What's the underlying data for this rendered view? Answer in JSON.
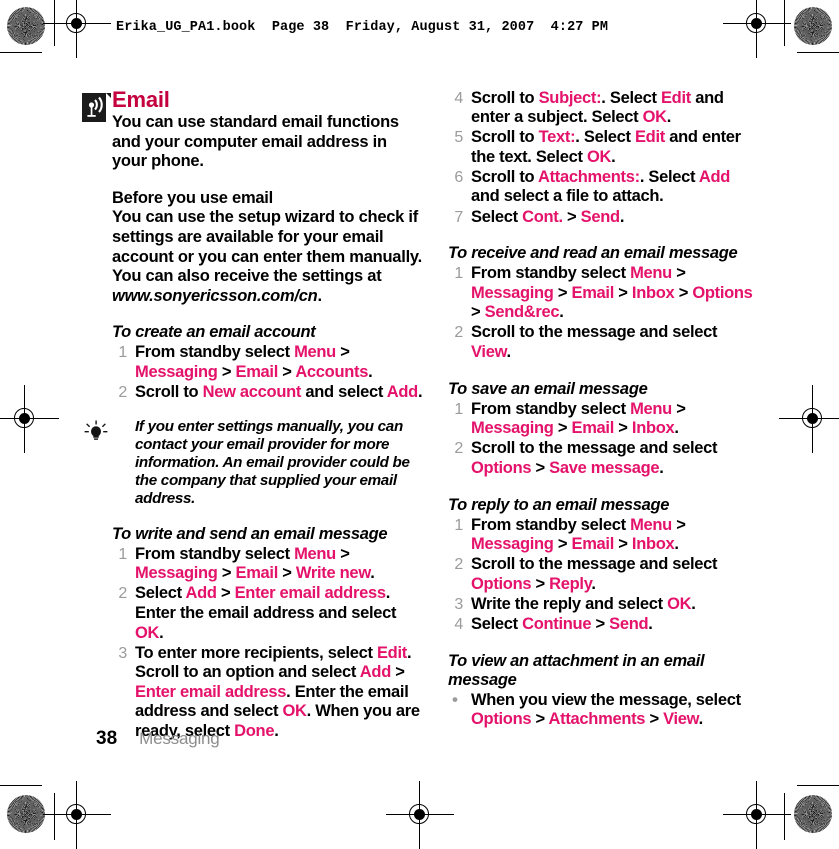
{
  "print_header": "Erika_UG_PA1.book  Page 38  Friday, August 31, 2007  4:27 PM",
  "colors": {
    "chapter_heading": "#C4003F",
    "ui_term": "#E4126A",
    "step_number": "#9B9B9B",
    "footer_section": "#8D8D8D"
  },
  "icons": {
    "section": "signal-wave-icon",
    "tip": "lightbulb-icon"
  },
  "chapter": {
    "title": "Email",
    "intro": "You can use standard email functions and your computer email address in your phone."
  },
  "left_column": {
    "before_heading": "Before you use email",
    "before_body_1": "You can use the setup wizard to check if settings are available for your email account or you can enter them manually. You can also receive the settings at ",
    "before_body_url": "www.sonyericsson.com/cn",
    "before_body_end": ".",
    "proc_create": {
      "heading": "To create an email account",
      "steps": [
        {
          "num": "1",
          "parts": [
            {
              "t": "From standby select ",
              "k": "plain"
            },
            {
              "t": "Menu",
              "k": "ui"
            },
            {
              "t": " > ",
              "k": "plain"
            },
            {
              "t": "Messaging",
              "k": "ui"
            },
            {
              "t": " > ",
              "k": "plain"
            },
            {
              "t": "Email",
              "k": "ui"
            },
            {
              "t": " > ",
              "k": "plain"
            },
            {
              "t": "Accounts",
              "k": "ui"
            },
            {
              "t": ".",
              "k": "plain"
            }
          ]
        },
        {
          "num": "2",
          "parts": [
            {
              "t": "Scroll to ",
              "k": "plain"
            },
            {
              "t": "New account",
              "k": "ui"
            },
            {
              "t": " and select ",
              "k": "plain"
            },
            {
              "t": "Add",
              "k": "ui"
            },
            {
              "t": ".",
              "k": "plain"
            }
          ]
        }
      ]
    },
    "tip": "If you enter settings manually, you can contact your email provider for more information. An email provider could be the company that supplied your email address.",
    "proc_write": {
      "heading": "To write and send an email message",
      "steps": [
        {
          "num": "1",
          "parts": [
            {
              "t": "From standby select ",
              "k": "plain"
            },
            {
              "t": "Menu",
              "k": "ui"
            },
            {
              "t": " > ",
              "k": "plain"
            },
            {
              "t": "Messaging",
              "k": "ui"
            },
            {
              "t": " > ",
              "k": "plain"
            },
            {
              "t": "Email",
              "k": "ui"
            },
            {
              "t": " > ",
              "k": "plain"
            },
            {
              "t": "Write new",
              "k": "ui"
            },
            {
              "t": ".",
              "k": "plain"
            }
          ]
        },
        {
          "num": "2",
          "parts": [
            {
              "t": "Select ",
              "k": "plain"
            },
            {
              "t": "Add",
              "k": "ui"
            },
            {
              "t": " > ",
              "k": "plain"
            },
            {
              "t": "Enter email address",
              "k": "ui"
            },
            {
              "t": ". Enter the email address and select ",
              "k": "plain"
            },
            {
              "t": "OK",
              "k": "ui"
            },
            {
              "t": ".",
              "k": "plain"
            }
          ]
        },
        {
          "num": "3",
          "parts": [
            {
              "t": "To enter more recipients, select ",
              "k": "plain"
            },
            {
              "t": "Edit",
              "k": "ui"
            },
            {
              "t": ". Scroll to an option and select ",
              "k": "plain"
            },
            {
              "t": "Add",
              "k": "ui"
            },
            {
              "t": " > ",
              "k": "plain"
            },
            {
              "t": "Enter email address",
              "k": "ui"
            },
            {
              "t": ". Enter the email address and select ",
              "k": "plain"
            },
            {
              "t": "OK",
              "k": "ui"
            },
            {
              "t": ". When you are ready, select ",
              "k": "plain"
            },
            {
              "t": "Done",
              "k": "ui"
            },
            {
              "t": ".",
              "k": "plain"
            }
          ]
        }
      ]
    }
  },
  "right_column": {
    "proc_write_cont": {
      "steps": [
        {
          "num": "4",
          "parts": [
            {
              "t": "Scroll to ",
              "k": "plain"
            },
            {
              "t": "Subject:",
              "k": "ui"
            },
            {
              "t": ". Select ",
              "k": "plain"
            },
            {
              "t": "Edit",
              "k": "ui"
            },
            {
              "t": " and enter a subject. Select ",
              "k": "plain"
            },
            {
              "t": "OK",
              "k": "ui"
            },
            {
              "t": ".",
              "k": "plain"
            }
          ]
        },
        {
          "num": "5",
          "parts": [
            {
              "t": "Scroll to ",
              "k": "plain"
            },
            {
              "t": "Text:",
              "k": "ui"
            },
            {
              "t": ". Select ",
              "k": "plain"
            },
            {
              "t": "Edit",
              "k": "ui"
            },
            {
              "t": " and enter the text. Select ",
              "k": "plain"
            },
            {
              "t": "OK",
              "k": "ui"
            },
            {
              "t": ".",
              "k": "plain"
            }
          ]
        },
        {
          "num": "6",
          "parts": [
            {
              "t": "Scroll to ",
              "k": "plain"
            },
            {
              "t": "Attachments:",
              "k": "ui"
            },
            {
              "t": ". Select ",
              "k": "plain"
            },
            {
              "t": "Add",
              "k": "ui"
            },
            {
              "t": " and select a file to attach.",
              "k": "plain"
            }
          ]
        },
        {
          "num": "7",
          "parts": [
            {
              "t": "Select ",
              "k": "plain"
            },
            {
              "t": "Cont.",
              "k": "ui"
            },
            {
              "t": " > ",
              "k": "plain"
            },
            {
              "t": "Send",
              "k": "ui"
            },
            {
              "t": ".",
              "k": "plain"
            }
          ]
        }
      ]
    },
    "proc_receive": {
      "heading": "To receive and read an email message",
      "steps": [
        {
          "num": "1",
          "parts": [
            {
              "t": "From standby select ",
              "k": "plain"
            },
            {
              "t": "Menu",
              "k": "ui"
            },
            {
              "t": " > ",
              "k": "plain"
            },
            {
              "t": "Messaging",
              "k": "ui"
            },
            {
              "t": " > ",
              "k": "plain"
            },
            {
              "t": "Email",
              "k": "ui"
            },
            {
              "t": " > ",
              "k": "plain"
            },
            {
              "t": "Inbox",
              "k": "ui"
            },
            {
              "t": " > ",
              "k": "plain"
            },
            {
              "t": "Options",
              "k": "ui"
            },
            {
              "t": " > ",
              "k": "plain"
            },
            {
              "t": "Send&rec",
              "k": "ui"
            },
            {
              "t": ".",
              "k": "plain"
            }
          ]
        },
        {
          "num": "2",
          "parts": [
            {
              "t": "Scroll to the message and select ",
              "k": "plain"
            },
            {
              "t": "View",
              "k": "ui"
            },
            {
              "t": ".",
              "k": "plain"
            }
          ]
        }
      ]
    },
    "proc_save": {
      "heading": "To save an email message",
      "steps": [
        {
          "num": "1",
          "parts": [
            {
              "t": "From standby select ",
              "k": "plain"
            },
            {
              "t": "Menu",
              "k": "ui"
            },
            {
              "t": " > ",
              "k": "plain"
            },
            {
              "t": "Messaging",
              "k": "ui"
            },
            {
              "t": " > ",
              "k": "plain"
            },
            {
              "t": "Email",
              "k": "ui"
            },
            {
              "t": " > ",
              "k": "plain"
            },
            {
              "t": "Inbox",
              "k": "ui"
            },
            {
              "t": ".",
              "k": "plain"
            }
          ]
        },
        {
          "num": "2",
          "parts": [
            {
              "t": "Scroll to the message and select ",
              "k": "plain"
            },
            {
              "t": "Options",
              "k": "ui"
            },
            {
              "t": " > ",
              "k": "plain"
            },
            {
              "t": "Save message",
              "k": "ui"
            },
            {
              "t": ".",
              "k": "plain"
            }
          ]
        }
      ]
    },
    "proc_reply": {
      "heading": "To reply to an email message",
      "steps": [
        {
          "num": "1",
          "parts": [
            {
              "t": "From standby select ",
              "k": "plain"
            },
            {
              "t": "Menu",
              "k": "ui"
            },
            {
              "t": " > ",
              "k": "plain"
            },
            {
              "t": "Messaging",
              "k": "ui"
            },
            {
              "t": " > ",
              "k": "plain"
            },
            {
              "t": "Email",
              "k": "ui"
            },
            {
              "t": " > ",
              "k": "plain"
            },
            {
              "t": "Inbox",
              "k": "ui"
            },
            {
              "t": ".",
              "k": "plain"
            }
          ]
        },
        {
          "num": "2",
          "parts": [
            {
              "t": "Scroll to the message and select ",
              "k": "plain"
            },
            {
              "t": "Options",
              "k": "ui"
            },
            {
              "t": " > ",
              "k": "plain"
            },
            {
              "t": "Reply",
              "k": "ui"
            },
            {
              "t": ".",
              "k": "plain"
            }
          ]
        },
        {
          "num": "3",
          "parts": [
            {
              "t": "Write the reply and select ",
              "k": "plain"
            },
            {
              "t": "OK",
              "k": "ui"
            },
            {
              "t": ".",
              "k": "plain"
            }
          ]
        },
        {
          "num": "4",
          "parts": [
            {
              "t": "Select ",
              "k": "plain"
            },
            {
              "t": "Continue",
              "k": "ui"
            },
            {
              "t": " > ",
              "k": "plain"
            },
            {
              "t": "Send",
              "k": "ui"
            },
            {
              "t": ".",
              "k": "plain"
            }
          ]
        }
      ]
    },
    "proc_attachment": {
      "heading": "To view an attachment in an email message",
      "steps": [
        {
          "num": "•",
          "parts": [
            {
              "t": "When you view the message, select ",
              "k": "plain"
            },
            {
              "t": "Options",
              "k": "ui"
            },
            {
              "t": " > ",
              "k": "plain"
            },
            {
              "t": "Attachments",
              "k": "ui"
            },
            {
              "t": " > ",
              "k": "plain"
            },
            {
              "t": "View",
              "k": "ui"
            },
            {
              "t": ".",
              "k": "plain"
            }
          ]
        }
      ]
    }
  },
  "footer": {
    "page_number": "38",
    "section": "Messaging"
  }
}
